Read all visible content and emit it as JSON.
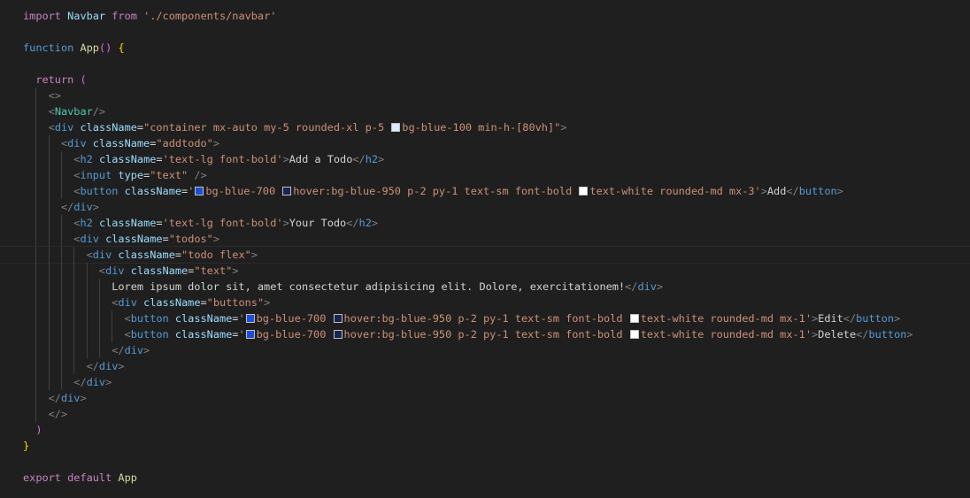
{
  "editor": {
    "language": "jsx",
    "colors": {
      "background": "#1f1f1f",
      "swatch_bg_blue_100": "#dbeafe",
      "swatch_bg_blue_700": "#1d4ed8",
      "swatch_bg_blue_950": "#172554",
      "swatch_text_white": "#ffffff"
    },
    "lines": [
      "import Navbar from './components/navbar'",
      "",
      "function App() {",
      "",
      "  return (",
      "    <>",
      "    <Navbar/>",
      "    <div className=\"container mx-auto my-5 rounded-xl p-5 bg-blue-100 min-h-[80vh]\">",
      "      <div className=\"addtodo\">",
      "        <h2 className='text-lg font-bold'>Add a Todo</h2>",
      "        <input type=\"text\" />",
      "        <button className='bg-blue-700 hover:bg-blue-950 p-2 py-1 text-sm font-bold text-white rounded-md mx-3'>Add</button>",
      "      </div>",
      "        <h2 className='text-lg font-bold'>Your Todo</h2>",
      "        <div className=\"todos\">",
      "          <div className=\"todo flex\">",
      "            <div className=\"text\">",
      "              Lorem ipsum dolor sit, amet consectetur adipisicing elit. Dolore, exercitationem!</div>",
      "              <div className=\"buttons\">",
      "                <button className='bg-blue-700 hover:bg-blue-950 p-2 py-1 text-sm font-bold text-white rounded-md mx-1'>Edit</button>",
      "                <button className='bg-blue-700 hover:bg-blue-950 p-2 py-1 text-sm font-bold text-white rounded-md mx-1'>Delete</button>",
      "              </div>",
      "          </div>",
      "        </div>",
      "    </div>",
      "    </>",
      "  )",
      "}",
      "",
      "export default App"
    ]
  }
}
